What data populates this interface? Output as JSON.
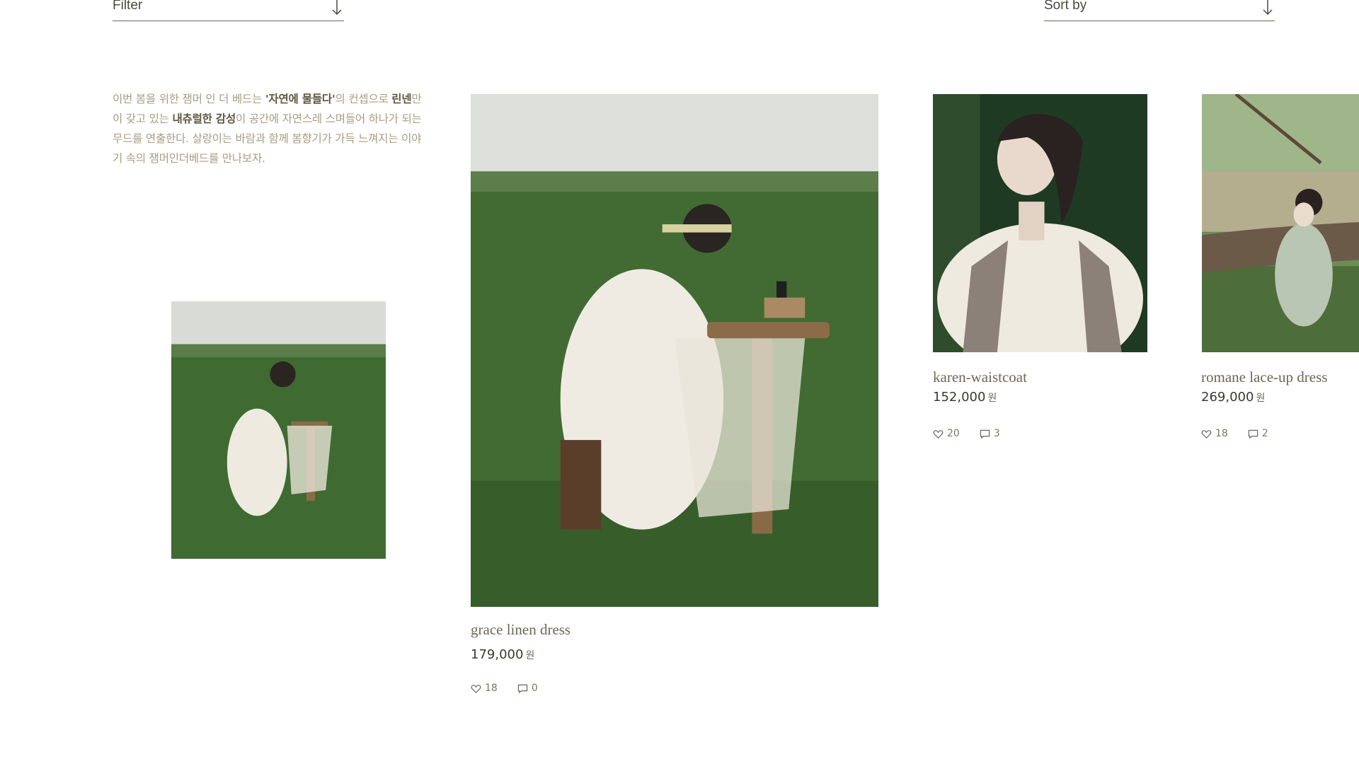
{
  "controls": {
    "filter_label": "Filter",
    "sort_label": "Sort by"
  },
  "intro": {
    "seg1": "이번 봄을 위한 잼머 인 더 베드는 ",
    "seg2": "'자연에 물들다'",
    "seg3": "의 컨셉으로 ",
    "seg4": "린넨",
    "seg5": "만이 갖고 있는 ",
    "seg6": "내츄럴한 감성",
    "seg7": "이 공간에 자연스레 스며들어 하나가 되는 무드를 연출한다. 살랑이는 바람과 함께 봄향기가 가득 느껴지는 이야기 속의 잼머인더베드를 만나보자."
  },
  "products": [
    {
      "name": "grace linen dress",
      "price": "179,000",
      "currency": "원",
      "likes": "18",
      "comments": "0"
    },
    {
      "name": "karen-waistcoat",
      "price": "152,000",
      "currency": "원",
      "likes": "20",
      "comments": "3"
    },
    {
      "name": "romane lace-up dress",
      "price": "269,000",
      "currency": "원",
      "likes": "18",
      "comments": "2"
    }
  ],
  "icons": {
    "arrow": "arrow-down-icon",
    "like": "heart-icon",
    "comment": "comment-icon"
  },
  "colors": {
    "intro_text": "#a59d80",
    "control_line": "#6e6a52",
    "field_green": "#3f6b32"
  }
}
